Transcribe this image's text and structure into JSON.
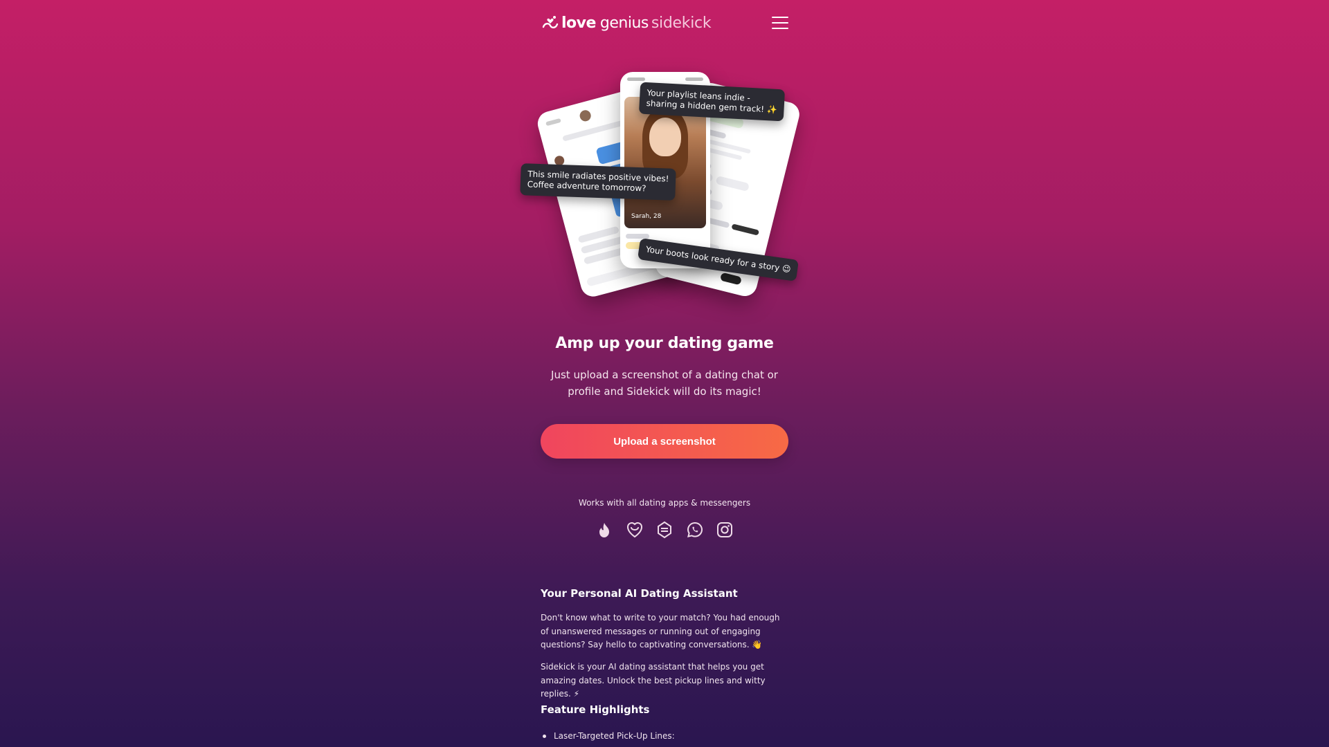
{
  "header": {
    "logo_love": "love",
    "logo_genius": "genius",
    "logo_sidekick": "sidekick",
    "menu_icon": "hamburger-menu-icon"
  },
  "hero": {
    "bubble_playlist": "Your playlist leans indie -\nsharing a hidden gem track! ✨",
    "bubble_smile": "This smile radiates positive vibes!\nCoffee adventure tomorrow?",
    "bubble_boots": "Your boots look ready for a story 😉",
    "profile_name": "Sarah, 28"
  },
  "main": {
    "headline": "Amp up your dating game",
    "subline": "Just upload a screenshot of a dating chat or profile and Sidekick will do its magic!",
    "cta_label": "Upload a screenshot",
    "works_with": "Works with all dating apps & messengers",
    "app_icons": [
      "tinder-icon",
      "bumble-icon",
      "hinge-icon",
      "whatsapp-icon",
      "instagram-icon"
    ]
  },
  "about": {
    "title": "Your Personal AI Dating Assistant",
    "para1": "Don't know what to write to your match? You had enough of unanswered messages or running out of engaging questions? Say hello to captivating conversations. 👋",
    "para2": "Sidekick is your AI dating assistant that helps you get amazing dates. Unlock the best pickup lines and witty replies. ⚡"
  },
  "features": {
    "title": "Feature Highlights",
    "items": [
      "Laser-Targeted Pick-Up Lines:"
    ]
  },
  "colors": {
    "bg_top": "#c41f66",
    "bg_bottom": "#2a1650",
    "cta_start": "#f0455e",
    "cta_end": "#f76a45"
  }
}
